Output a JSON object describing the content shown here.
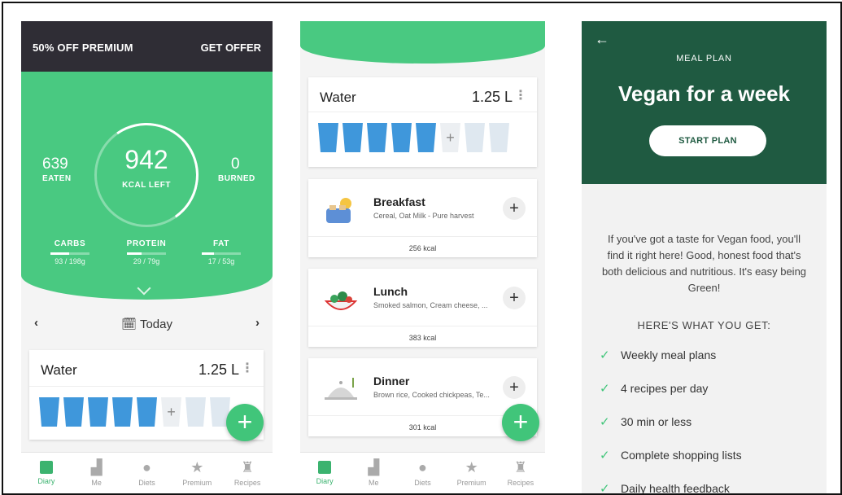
{
  "screen1": {
    "promo": {
      "left": "50% OFF PREMIUM",
      "right": "GET OFFER"
    },
    "summary": {
      "eaten_value": "639",
      "eaten_label": "EATEN",
      "kcal_left_value": "942",
      "kcal_left_label": "KCAL LEFT",
      "burned_value": "0",
      "burned_label": "BURNED"
    },
    "macros": [
      {
        "label": "CARBS",
        "value": "93 / 198g",
        "fraction": 0.47
      },
      {
        "label": "PROTEIN",
        "value": "29 / 79g",
        "fraction": 0.37
      },
      {
        "label": "FAT",
        "value": "17 / 53g",
        "fraction": 0.32
      }
    ],
    "day": {
      "prev": "‹",
      "label": "🗓 Today",
      "next": "›"
    },
    "water": {
      "title": "Water",
      "value": "1.25 L",
      "menu": "⋮",
      "add": "+"
    },
    "fab": "+"
  },
  "screen2": {
    "water": {
      "title": "Water",
      "value": "1.25 L",
      "menu": "⋮",
      "add": "+"
    },
    "meals": [
      {
        "title": "Breakfast",
        "subtitle": "Cereal, Oat Milk - Pure harvest",
        "kcal": "256 kcal",
        "add": "+"
      },
      {
        "title": "Lunch",
        "subtitle": "Smoked salmon, Cream cheese, ...",
        "kcal": "383 kcal",
        "add": "+"
      },
      {
        "title": "Dinner",
        "subtitle": "Brown rice, Cooked chickpeas, Te...",
        "kcal": "301 kcal",
        "add": "+"
      }
    ],
    "fab": "+"
  },
  "tabs": [
    {
      "label": "Diary",
      "icon": "diary-icon"
    },
    {
      "label": "Me",
      "icon": "chart-icon"
    },
    {
      "label": "Diets",
      "icon": "apple-icon"
    },
    {
      "label": "Premium",
      "icon": "star-icon"
    },
    {
      "label": "Recipes",
      "icon": "chef-hat-icon"
    }
  ],
  "screen3": {
    "back": "←",
    "overline": "MEAL PLAN",
    "title": "Vegan for a week",
    "cta": "START PLAN",
    "description": "If you've got a taste for Vegan food, you'll find it right here! Good, honest food that's both delicious and nutritious. It's easy being Green!",
    "features_heading": "HERE'S WHAT YOU GET:",
    "features": [
      "Weekly meal plans",
      "4 recipes per day",
      "30 min or less",
      "Complete shopping lists",
      "Daily health feedback"
    ],
    "check": "✓"
  },
  "colors": {
    "green": "#49c981",
    "dark_green": "#1f5a41",
    "water_blue": "#3f97db",
    "promo_bg": "#2f2d35"
  }
}
